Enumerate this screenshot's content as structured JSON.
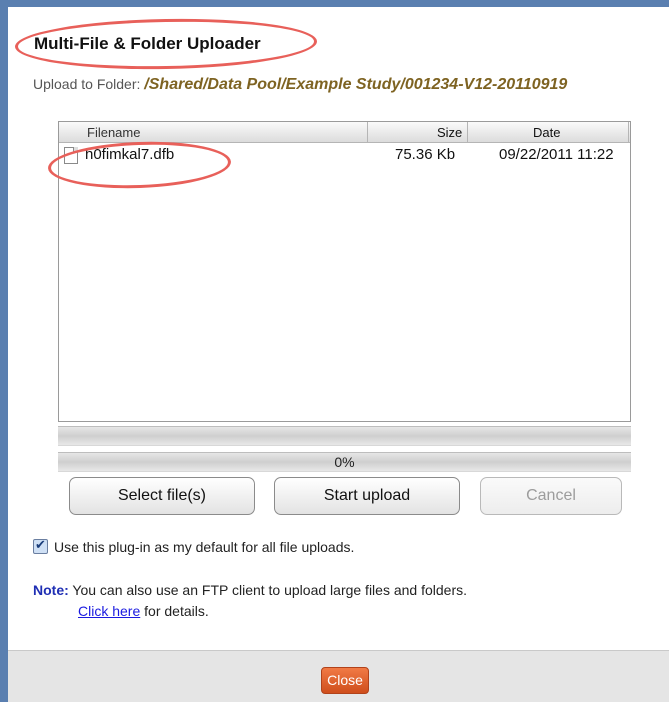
{
  "dialog": {
    "title": "Multi-File & Folder Uploader",
    "upload_to_label": "Upload to Folder: ",
    "upload_path": "/Shared/Data Pool/Example Study/001234-V12-20110919"
  },
  "filelist": {
    "columns": {
      "name": "Filename",
      "size": "Size",
      "date": "Date"
    },
    "rows": [
      {
        "name": "h0fimkal7.dfb",
        "size": "75.36 Kb",
        "date": "09/22/2011 11:22"
      }
    ]
  },
  "progress": {
    "text": "0%",
    "value": 0
  },
  "buttons": {
    "select_files": "Select file(s)",
    "start_upload": "Start upload",
    "cancel": "Cancel",
    "close": "Close"
  },
  "default_option": {
    "label": "Use this plug-in as my default for all file uploads.",
    "checked": true
  },
  "note": {
    "label": "Note:",
    "text": "You can also use an FTP client to upload large files and folders.",
    "link_text": "Click here",
    "link_suffix": " for details."
  },
  "colors": {
    "annotation": "#e8605a",
    "path": "#7e6322",
    "close_button": "#e0602c",
    "link": "#1a1ae0"
  }
}
